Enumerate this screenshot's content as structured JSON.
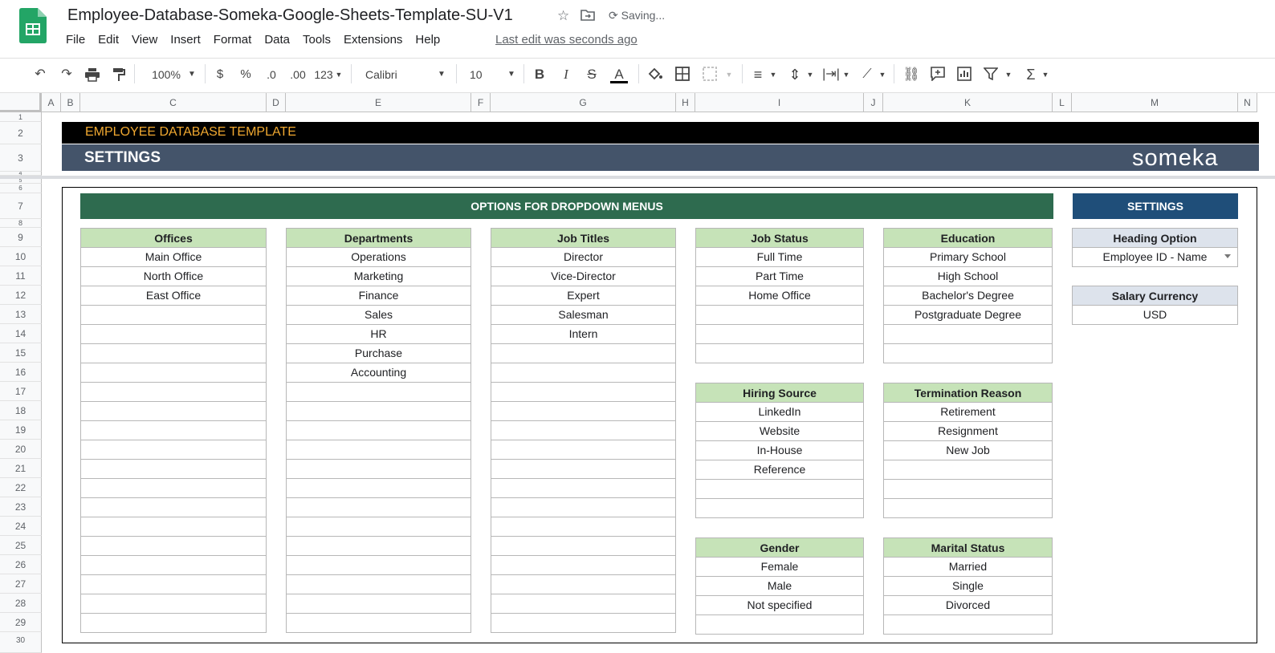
{
  "app": {
    "doc_title": "Employee-Database-Someka-Google-Sheets-Template-SU-V1",
    "saving_status": "Saving...",
    "last_edit": "Last edit was seconds ago",
    "menu": [
      "File",
      "Edit",
      "View",
      "Insert",
      "Format",
      "Data",
      "Tools",
      "Extensions",
      "Help"
    ]
  },
  "toolbar": {
    "zoom": "100%",
    "currency": "$",
    "percent": "%",
    "dec_decrease": ".0",
    "dec_increase": ".00",
    "number_format": "123",
    "font": "Calibri",
    "font_size": "10",
    "bold": "B",
    "italic": "I",
    "strike": "S",
    "text_color": "A",
    "sum": "Σ"
  },
  "columns": [
    "A",
    "B",
    "C",
    "D",
    "E",
    "F",
    "G",
    "H",
    "I",
    "J",
    "K",
    "L",
    "M",
    "N"
  ],
  "rows": [
    "1",
    "2",
    "3",
    "4",
    "5",
    "6",
    "7",
    "8",
    "9",
    "10",
    "11",
    "12",
    "13",
    "14",
    "15",
    "16",
    "17",
    "18",
    "19",
    "20",
    "21",
    "22",
    "23",
    "24",
    "25",
    "26",
    "27",
    "28",
    "29",
    "30"
  ],
  "sheet": {
    "banner_title": "EMPLOYEE DATABASE TEMPLATE",
    "page_title": "SETTINGS",
    "brand": "someka",
    "options_header": "OPTIONS FOR DROPDOWN MENUS",
    "settings_header": "SETTINGS",
    "lists": {
      "offices": {
        "title": "Offices",
        "items": [
          "Main Office",
          "North Office",
          "East Office"
        ]
      },
      "departments": {
        "title": "Departments",
        "items": [
          "Operations",
          "Marketing",
          "Finance",
          "Sales",
          "HR",
          "Purchase",
          "Accounting"
        ]
      },
      "job_titles": {
        "title": "Job Titles",
        "items": [
          "Director",
          "Vice-Director",
          "Expert",
          "Salesman",
          "Intern"
        ]
      },
      "job_status": {
        "title": "Job Status",
        "items": [
          "Full Time",
          "Part Time",
          "Home Office"
        ]
      },
      "education": {
        "title": "Education",
        "items": [
          "Primary School",
          "High School",
          "Bachelor's Degree",
          "Postgraduate Degree"
        ]
      },
      "hiring_source": {
        "title": "Hiring Source",
        "items": [
          "LinkedIn",
          "Website",
          "In-House",
          "Reference"
        ]
      },
      "termination_reason": {
        "title": "Termination Reason",
        "items": [
          "Retirement",
          "Resignment",
          "New Job"
        ]
      },
      "gender": {
        "title": "Gender",
        "items": [
          "Female",
          "Male",
          "Not specified"
        ]
      },
      "marital_status": {
        "title": "Marital Status",
        "items": [
          "Married",
          "Single",
          "Divorced"
        ]
      }
    },
    "settings": {
      "heading_option_label": "Heading Option",
      "heading_option_value": "Employee ID - Name",
      "salary_currency_label": "Salary Currency",
      "salary_currency_value": "USD"
    }
  }
}
